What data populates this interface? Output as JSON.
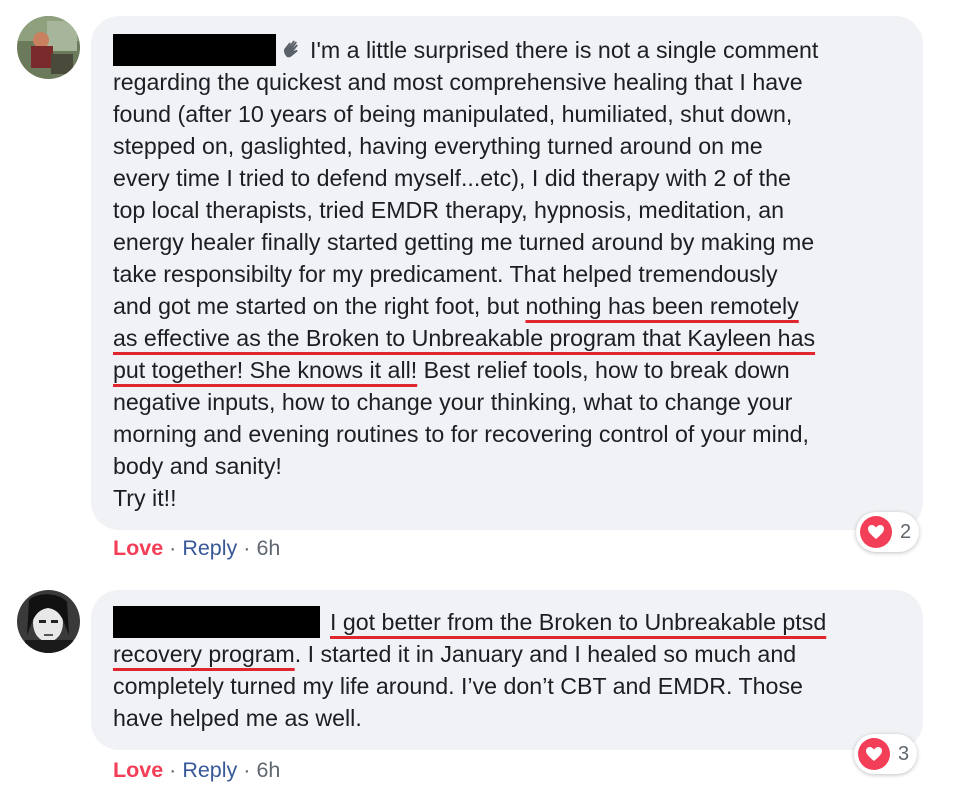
{
  "comments": [
    {
      "lines": [
        "I'm a little surprised there is not a single comment",
        "regarding the quickest and most comprehensive healing that I have",
        "found (after 10 years of being manipulated, humiliated, shut down,",
        "stepped on, gaslighted, having everything turned around on me",
        "every time I tried to defend myself...etc), I did therapy with 2 of the",
        "top local therapists, tried EMDR therapy, hypnosis, meditation, an",
        "energy healer finally started getting me turned around by making me",
        "take responsibilty for my predicament. That helped tremendously",
        "and got me started on the right foot, but ",
        "nothing has been remotely",
        "as effective as the Broken to Unbreakable program that Kayleen has",
        "put together! She knows it all!",
        " Best relief tools, how to break down",
        "negative inputs, how to change your thinking, what to change your",
        "morning and evening routines to for recovering control of your mind,",
        "body and sanity!",
        "Try it!!"
      ],
      "love_label": "Love",
      "sep": "·",
      "reply_label": "Reply",
      "time": "6h",
      "reaction_count": "2"
    },
    {
      "lines": [
        "I got better from the Broken to Unbreakable ptsd",
        "recovery program",
        ". I started it in January and I healed so much and",
        "completely turned my life around. I’ve don’t CBT and EMDR. Those",
        "have helped me as well."
      ],
      "love_label": "Love",
      "sep": "·",
      "reply_label": "Reply",
      "time": "6h",
      "reaction_count": "3"
    }
  ],
  "colors": {
    "love": "#f33e58",
    "reply": "#385898",
    "underline": "#e0272f",
    "bubble": "#f0f2f5"
  },
  "icons": [
    "waving-hand-icon",
    "heart-icon"
  ]
}
